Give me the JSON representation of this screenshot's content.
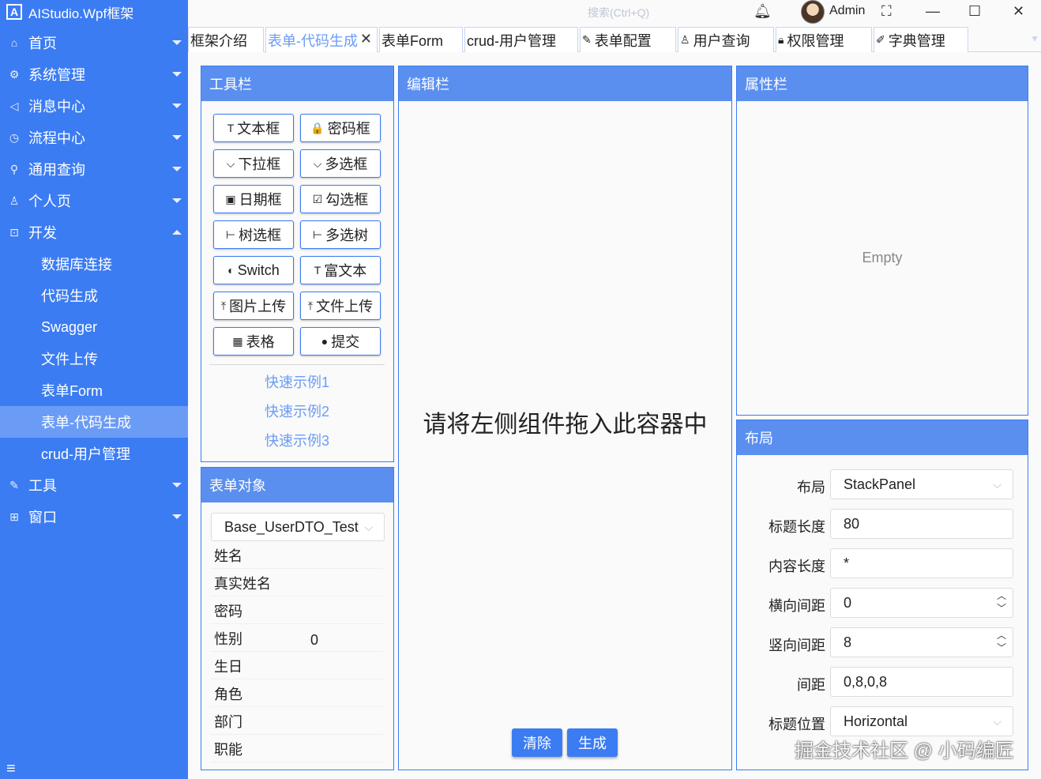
{
  "app": {
    "title": "AIStudio.Wpf框架",
    "logo_letter": "A"
  },
  "titlebar": {
    "search_placeholder": "搜索(Ctrl+Q)",
    "user_name": "Admin"
  },
  "sidebar": {
    "items": [
      {
        "label": "首页",
        "icon": "home-icon"
      },
      {
        "label": "系统管理",
        "icon": "gear-icon"
      },
      {
        "label": "消息中心",
        "icon": "megaphone-icon"
      },
      {
        "label": "流程中心",
        "icon": "clock-icon"
      },
      {
        "label": "通用查询",
        "icon": "search-icon"
      },
      {
        "label": "个人页",
        "icon": "user-icon"
      },
      {
        "label": "开发",
        "icon": "code-icon"
      }
    ],
    "dev_children": [
      "数据库连接",
      "代码生成",
      "Swagger",
      "文件上传",
      "表单Form",
      "表单-代码生成",
      "crud-用户管理"
    ],
    "active_child": "表单-代码生成",
    "bottom_items": [
      {
        "label": "工具",
        "icon": "wrench-icon"
      },
      {
        "label": "窗口",
        "icon": "window-icon"
      }
    ]
  },
  "tabs": [
    {
      "label": "框架介绍"
    },
    {
      "label": "表单-代码生成",
      "active": true
    },
    {
      "label": "表单Form"
    },
    {
      "label": "crud-用户管理"
    },
    {
      "label": "表单配置",
      "icon": "edit-icon"
    },
    {
      "label": "用户查询",
      "icon": "user-icon"
    },
    {
      "label": "权限管理",
      "icon": "lock-icon"
    },
    {
      "label": "字典管理",
      "icon": "pencil-icon"
    }
  ],
  "toolbar": {
    "title": "工具栏",
    "buttons": [
      {
        "label": "文本框",
        "icon": "T"
      },
      {
        "label": "密码框",
        "icon": "🔒"
      },
      {
        "label": "下拉框",
        "icon": "⌵"
      },
      {
        "label": "多选框",
        "icon": "⌵"
      },
      {
        "label": "日期框",
        "icon": "▣"
      },
      {
        "label": "勾选框",
        "icon": "☑"
      },
      {
        "label": "树选框",
        "icon": "⊢"
      },
      {
        "label": "多选树",
        "icon": "⊢"
      },
      {
        "label": "Switch",
        "icon": "◐"
      },
      {
        "label": "富文本",
        "icon": "T"
      },
      {
        "label": "图片上传",
        "icon": "⤒"
      },
      {
        "label": "文件上传",
        "icon": "⤒"
      },
      {
        "label": "表格",
        "icon": "▦"
      },
      {
        "label": "提交",
        "icon": "●"
      }
    ],
    "links": [
      "快速示例1",
      "快速示例2",
      "快速示例3"
    ]
  },
  "form_object": {
    "title": "表单对象",
    "selected": "Base_UserDTO_Test",
    "fields": [
      {
        "name": "姓名",
        "value": ""
      },
      {
        "name": "真实姓名",
        "value": ""
      },
      {
        "name": "密码",
        "value": ""
      },
      {
        "name": "性别",
        "value": "0"
      },
      {
        "name": "生日",
        "value": ""
      },
      {
        "name": "角色",
        "value": ""
      },
      {
        "name": "部门",
        "value": ""
      },
      {
        "name": "职能",
        "value": ""
      }
    ]
  },
  "editor": {
    "title": "编辑栏",
    "hint": "请将左侧组件拖入此容器中",
    "clear_label": "清除",
    "generate_label": "生成"
  },
  "properties": {
    "title": "属性栏",
    "empty_text": "Empty"
  },
  "layout": {
    "title": "布局",
    "fields": [
      {
        "label": "布局",
        "value": "StackPanel",
        "kind": "select"
      },
      {
        "label": "标题长度",
        "value": "80",
        "kind": "text"
      },
      {
        "label": "内容长度",
        "value": "*",
        "kind": "text"
      },
      {
        "label": "横向间距",
        "value": "0",
        "kind": "spin"
      },
      {
        "label": "竖向间距",
        "value": "8",
        "kind": "spin"
      },
      {
        "label": "间距",
        "value": "0,8,0,8",
        "kind": "text"
      },
      {
        "label": "标题位置",
        "value": "Horizontal",
        "kind": "select"
      }
    ]
  },
  "watermark": "掘金技术社区 @ 小码编匠"
}
